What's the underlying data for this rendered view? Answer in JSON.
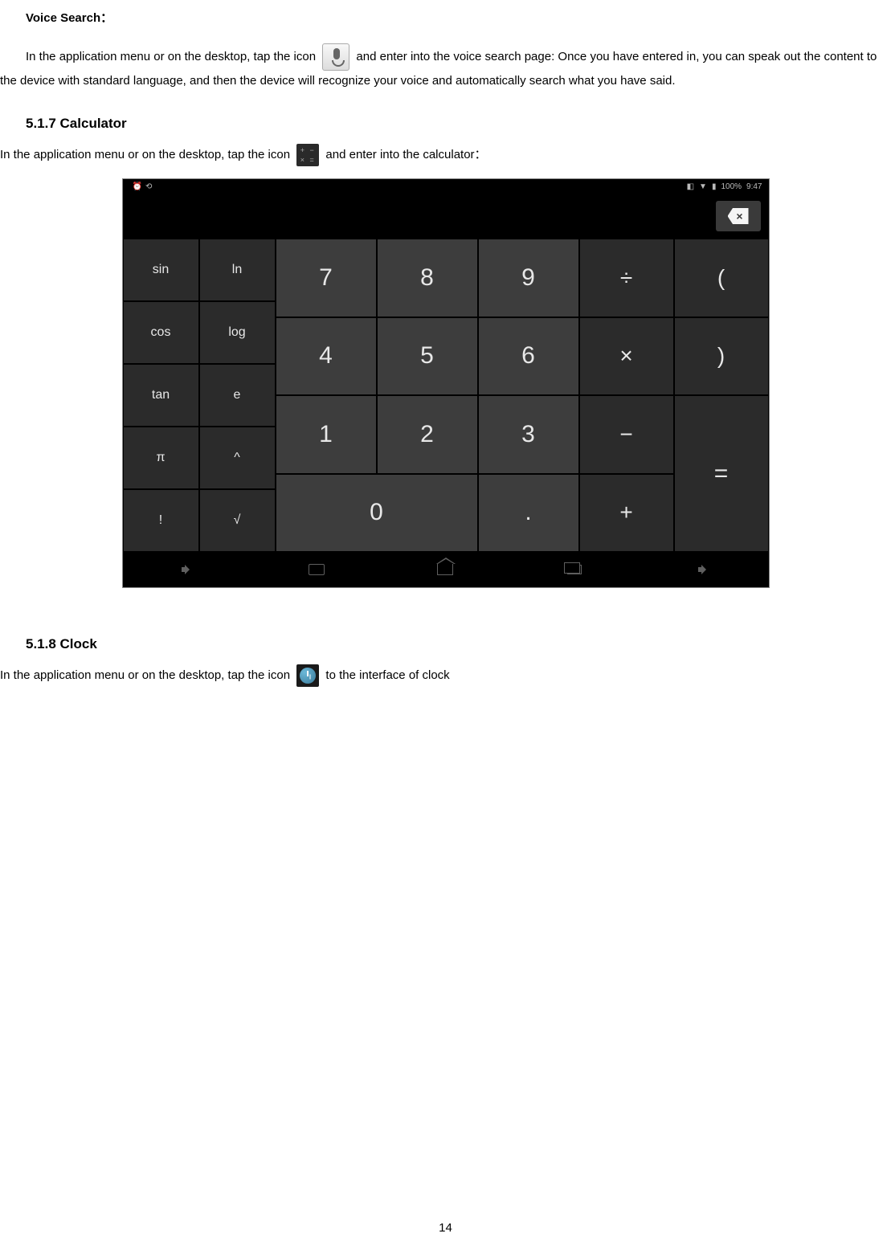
{
  "voice_search": {
    "heading": "Voice Search：",
    "text_before_icon": "In the application menu or on the desktop, tap the icon ",
    "text_after_icon": " and enter into the voice search page: Once you have entered in, you can speak out the content to the device with standard language, and then the device will recognize your voice and automatically search what you have said."
  },
  "calculator": {
    "heading": "5.1.7 Calculator",
    "text_before_icon": "In the application menu or on the desktop, tap the icon ",
    "text_after_icon": " and enter into the calculator：",
    "status": {
      "battery": "100%",
      "time": "9:47"
    },
    "keys": {
      "func": [
        "sin",
        "ln",
        "cos",
        "log",
        "tan",
        "e",
        "π",
        "^",
        "!",
        "√"
      ],
      "nums": [
        "7",
        "8",
        "9",
        "4",
        "5",
        "6",
        "1",
        "2",
        "3",
        "0",
        "."
      ],
      "ops": [
        "÷",
        "×",
        "−",
        "+"
      ],
      "parens": [
        "(",
        ")"
      ],
      "eq": "="
    }
  },
  "clock": {
    "heading": "5.1.8 Clock",
    "text_before_icon": "In the application menu or on the desktop, tap the icon ",
    "text_after_icon": " to the interface of clock"
  },
  "page_number": "14"
}
